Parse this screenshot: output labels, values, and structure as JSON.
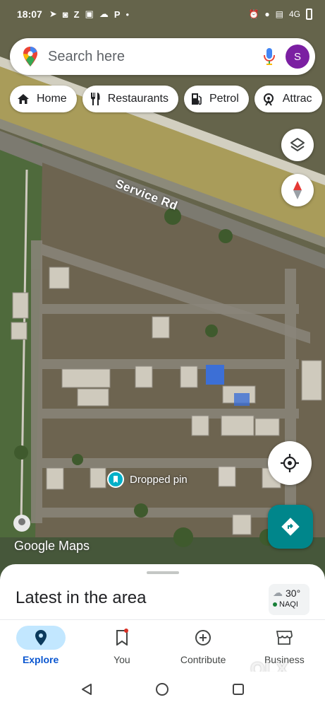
{
  "status_bar": {
    "time": "18:07",
    "left_icons": [
      "telegram-icon",
      "whatsapp-icon",
      "z-app-icon",
      "gallery-icon",
      "snapchat-icon",
      "p-app-icon",
      "dot"
    ],
    "right_icons": [
      "alarm-icon",
      "location-icon",
      "volte-icon",
      "signal-4g-icon",
      "battery-icon"
    ],
    "network": "4G"
  },
  "search": {
    "placeholder": "Search here",
    "avatar_letter": "S"
  },
  "chips": [
    {
      "label": "Home",
      "icon": "home-icon"
    },
    {
      "label": "Restaurants",
      "icon": "restaurant-icon"
    },
    {
      "label": "Petrol",
      "icon": "fuel-icon"
    },
    {
      "label": "Attrac",
      "icon": "attractions-icon"
    }
  ],
  "map": {
    "street_label": "Service Rd",
    "dropped_pin_label": "Dropped pin",
    "attribution": "Google Maps",
    "layers_icon": "layers-icon",
    "compass_icon": "compass-icon",
    "location_icon": "my-location-icon",
    "directions_icon": "directions-icon"
  },
  "sheet": {
    "title": "Latest in the area",
    "weather": {
      "temperature": "30°",
      "aqi_label": "NAQI"
    }
  },
  "bottom_nav": [
    {
      "label": "Explore",
      "icon": "explore-pin-icon",
      "active": true
    },
    {
      "label": "You",
      "icon": "bookmark-icon",
      "active": false
    },
    {
      "label": "Contribute",
      "icon": "add-circle-icon",
      "active": false
    },
    {
      "label": "Business",
      "icon": "storefront-icon",
      "active": false
    }
  ],
  "watermark": "OLX",
  "colors": {
    "accent": "#0b57d0",
    "explore_pill": "#c2e7ff",
    "directions_button": "#00868b",
    "avatar": "#7b1fa2",
    "pin": "#00b0c8"
  }
}
